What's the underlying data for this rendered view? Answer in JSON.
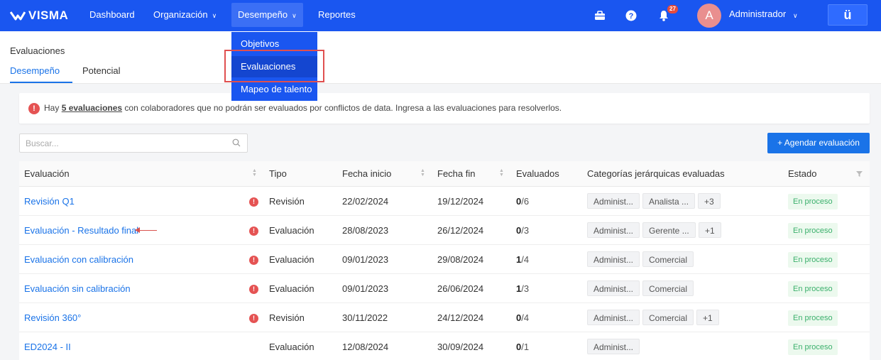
{
  "brand": "VISMA",
  "nav": {
    "dashboard": "Dashboard",
    "organizacion": "Organización",
    "desempeno": "Desempeño",
    "reportes": "Reportes"
  },
  "dropdown": {
    "items": [
      "Objetivos",
      "Evaluaciones",
      "Mapeo de talento"
    ]
  },
  "user": {
    "avatar_initial": "A",
    "name": "Administrador",
    "notification_count": "27",
    "app_button": "ü"
  },
  "page": {
    "title": "Evaluaciones",
    "tabs": [
      "Desempeño",
      "Potencial"
    ]
  },
  "alert": {
    "icon": "!",
    "prefix": "Hay ",
    "link": "5 evaluaciones",
    "suffix": " con colaboradores que no podrán ser evaluados por conflictos de data. Ingresa a las evaluaciones para resolverlos."
  },
  "search": {
    "placeholder": "Buscar..."
  },
  "actions": {
    "schedule": "+ Agendar evaluación"
  },
  "table": {
    "headers": [
      "Evaluación",
      "Tipo",
      "Fecha inicio",
      "Fecha fin",
      "Evaluados",
      "Categorías jerárquicas evaluadas",
      "Estado"
    ],
    "rows": [
      {
        "name": "Revisión Q1",
        "warning": true,
        "type": "Revisión",
        "start": "22/02/2024",
        "end": "19/12/2024",
        "evaluated": "0",
        "total": "/6",
        "categories": [
          "Administ...",
          "Analista ...",
          "+3"
        ],
        "status": "En proceso"
      },
      {
        "name": "Evaluación - Resultado final",
        "warning": true,
        "type": "Evaluación",
        "start": "28/08/2023",
        "end": "26/12/2024",
        "evaluated": "0",
        "total": "/3",
        "categories": [
          "Administ...",
          "Gerente ...",
          "+1"
        ],
        "status": "En proceso"
      },
      {
        "name": "Evaluación con calibración",
        "warning": true,
        "type": "Evaluación",
        "start": "09/01/2023",
        "end": "29/08/2024",
        "evaluated": "1",
        "total": "/4",
        "categories": [
          "Administ...",
          "Comercial"
        ],
        "status": "En proceso"
      },
      {
        "name": "Evaluación sin calibración",
        "warning": true,
        "type": "Evaluación",
        "start": "09/01/2023",
        "end": "26/06/2024",
        "evaluated": "1",
        "total": "/3",
        "categories": [
          "Administ...",
          "Comercial"
        ],
        "status": "En proceso"
      },
      {
        "name": "Revisión 360°",
        "warning": true,
        "type": "Revisión",
        "start": "30/11/2022",
        "end": "24/12/2024",
        "evaluated": "0",
        "total": "/4",
        "categories": [
          "Administ...",
          "Comercial",
          "+1"
        ],
        "status": "En proceso"
      },
      {
        "name": "ED2024 - II",
        "warning": false,
        "type": "Evaluación",
        "start": "12/08/2024",
        "end": "30/09/2024",
        "evaluated": "0",
        "total": "/1",
        "categories": [
          "Administ..."
        ],
        "status": "En proceso"
      }
    ]
  },
  "colors": {
    "nav_bg": "#1a56f0",
    "accent": "#1a73e8",
    "warning": "#e55353",
    "status_green": "#3bb06c",
    "highlight_red": "#e05050"
  }
}
